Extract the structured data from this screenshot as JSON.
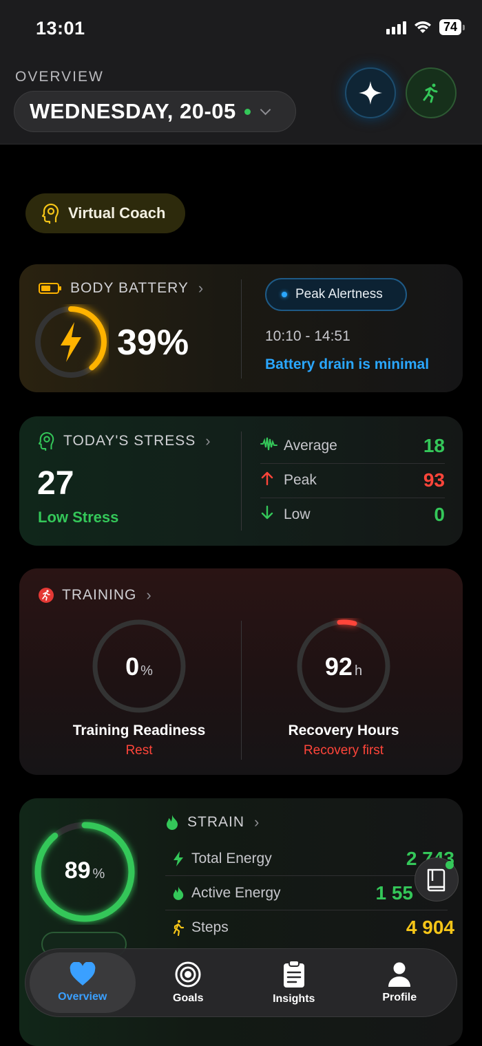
{
  "status_bar": {
    "time": "13:01",
    "battery": "74"
  },
  "header": {
    "overview_label": "OVERVIEW",
    "date": "WEDNESDAY, 20-05"
  },
  "coach": {
    "label": "Virtual Coach"
  },
  "body_battery": {
    "title": "BODY BATTERY",
    "value": "39%",
    "level_fraction": 0.39,
    "badge": "Peak Alertness",
    "time_range": "10:10 - 14:51",
    "message": "Battery drain is minimal"
  },
  "stress": {
    "title": "TODAY'S STRESS",
    "value": "27",
    "level_label": "Low Stress",
    "rows": [
      {
        "label": "Average",
        "value": "18",
        "color": "#34c759"
      },
      {
        "label": "Peak",
        "value": "93",
        "color": "#ff453a"
      },
      {
        "label": "Low",
        "value": "0",
        "color": "#34c759"
      }
    ]
  },
  "training": {
    "title": "TRAINING",
    "readiness": {
      "value": "0",
      "unit": "%",
      "label": "Training Readiness",
      "status": "Rest"
    },
    "recovery": {
      "value": "92",
      "unit": "h",
      "label": "Recovery Hours",
      "status": "Recovery first"
    }
  },
  "strain": {
    "title": "STRAIN",
    "value": "89",
    "unit": "%",
    "ring_fraction": 0.89,
    "rows": [
      {
        "label": "Total Energy",
        "value": "2 743",
        "color": "#34c759"
      },
      {
        "label": "Active Energy",
        "value": "1 55",
        "color": "#34c759"
      },
      {
        "label": "Steps",
        "value": "4 904",
        "color": "#f5c518"
      }
    ]
  },
  "nav": [
    {
      "label": "Overview"
    },
    {
      "label": "Goals"
    },
    {
      "label": "Insights"
    },
    {
      "label": "Profile"
    }
  ],
  "colors": {
    "accent": "#3aa0ff",
    "battery": "#ffb300",
    "green": "#34c759",
    "red": "#ff453a",
    "yellow": "#f5c518"
  }
}
